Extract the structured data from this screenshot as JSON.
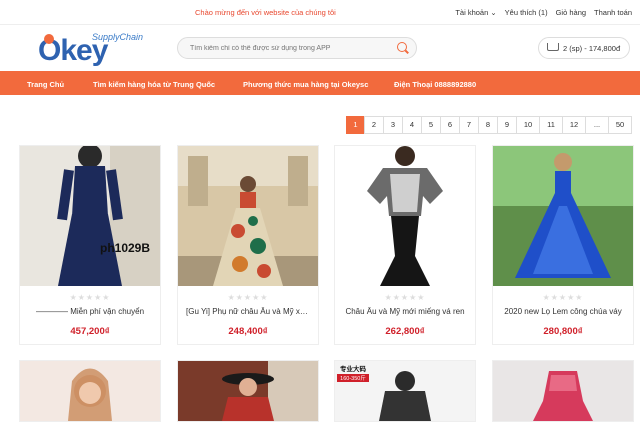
{
  "topbar": {
    "welcome": "Chào mừng đến với website của chúng tôi",
    "account": "Tài khoản",
    "favorites": "Yêu thích (1)",
    "cart": "Giỏ hàng",
    "checkout": "Thanh toán"
  },
  "logo": {
    "word": "Okey",
    "tagline": "SupplyChain"
  },
  "search": {
    "placeholder": "Tìm kiếm chỉ có thể được sử dụng trong APP"
  },
  "cart": {
    "summary": "2 (sp) - 174,800đ"
  },
  "nav": {
    "home": "Trang Chủ",
    "search_china": "Tìm kiếm hàng hóa từ Trung Quốc",
    "buy_method": "Phương thức mua hàng tại Okeysc",
    "phone": "Điện Thoại 0888892880"
  },
  "pager": [
    "1",
    "2",
    "3",
    "4",
    "5",
    "6",
    "7",
    "8",
    "9",
    "10",
    "11",
    "12",
    "...",
    "50"
  ],
  "products": [
    {
      "title": "———— Miễn phí vận chuyển",
      "price": "457,200₫",
      "tag": "ph1029B",
      "bg": "#1c2a5a",
      "accent": "#e9e6df"
    },
    {
      "title": "[Gu Yi] Phụ nữ châu Âu và Mỹ xuân",
      "price": "248,400₫",
      "bg": "#c94b32",
      "accent": "#c8b89a"
    },
    {
      "title": "Châu Âu và Mỹ mới miếng vá ren",
      "price": "262,800₫",
      "bg": "#1a1a1a",
      "accent": "#ffffff"
    },
    {
      "title": "2020 new Lọ Lem công chúa váy",
      "price": "280,800₫",
      "bg": "#1f4fc9",
      "accent": "#8cc67a"
    }
  ],
  "second_row": [
    {
      "bg": "#d9a98a"
    },
    {
      "bg": "#b8322b"
    },
    {
      "badge": "专业大码",
      "badge2": "160-350斤",
      "bg": "#333333"
    },
    {
      "bg": "#d63a5c"
    }
  ],
  "colors": {
    "accent": "#f26a3d",
    "price": "#d0202a",
    "brand": "#2e62b0"
  }
}
